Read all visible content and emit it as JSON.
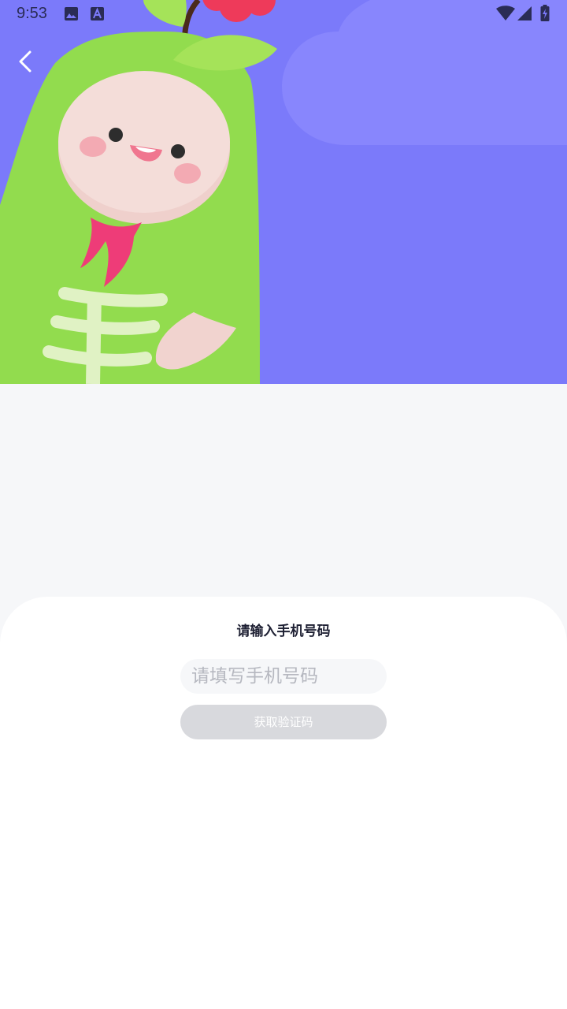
{
  "status_bar": {
    "time": "9:53",
    "icons": [
      "image-icon",
      "a-box-icon",
      "wifi-icon",
      "signal-icon",
      "battery-charging-icon"
    ]
  },
  "header": {
    "back_icon": "chevron-left-icon",
    "background_color": "#7b7afa"
  },
  "login": {
    "title": "请输入手机号码",
    "phone_placeholder": "请填写手机号码",
    "phone_value": "",
    "get_code_label": "获取验证码"
  },
  "colors": {
    "accent_purple": "#7b7afa",
    "mascot_green": "#92dc4e",
    "button_disabled": "#d8d9dd",
    "page_background": "#f6f7f9"
  }
}
